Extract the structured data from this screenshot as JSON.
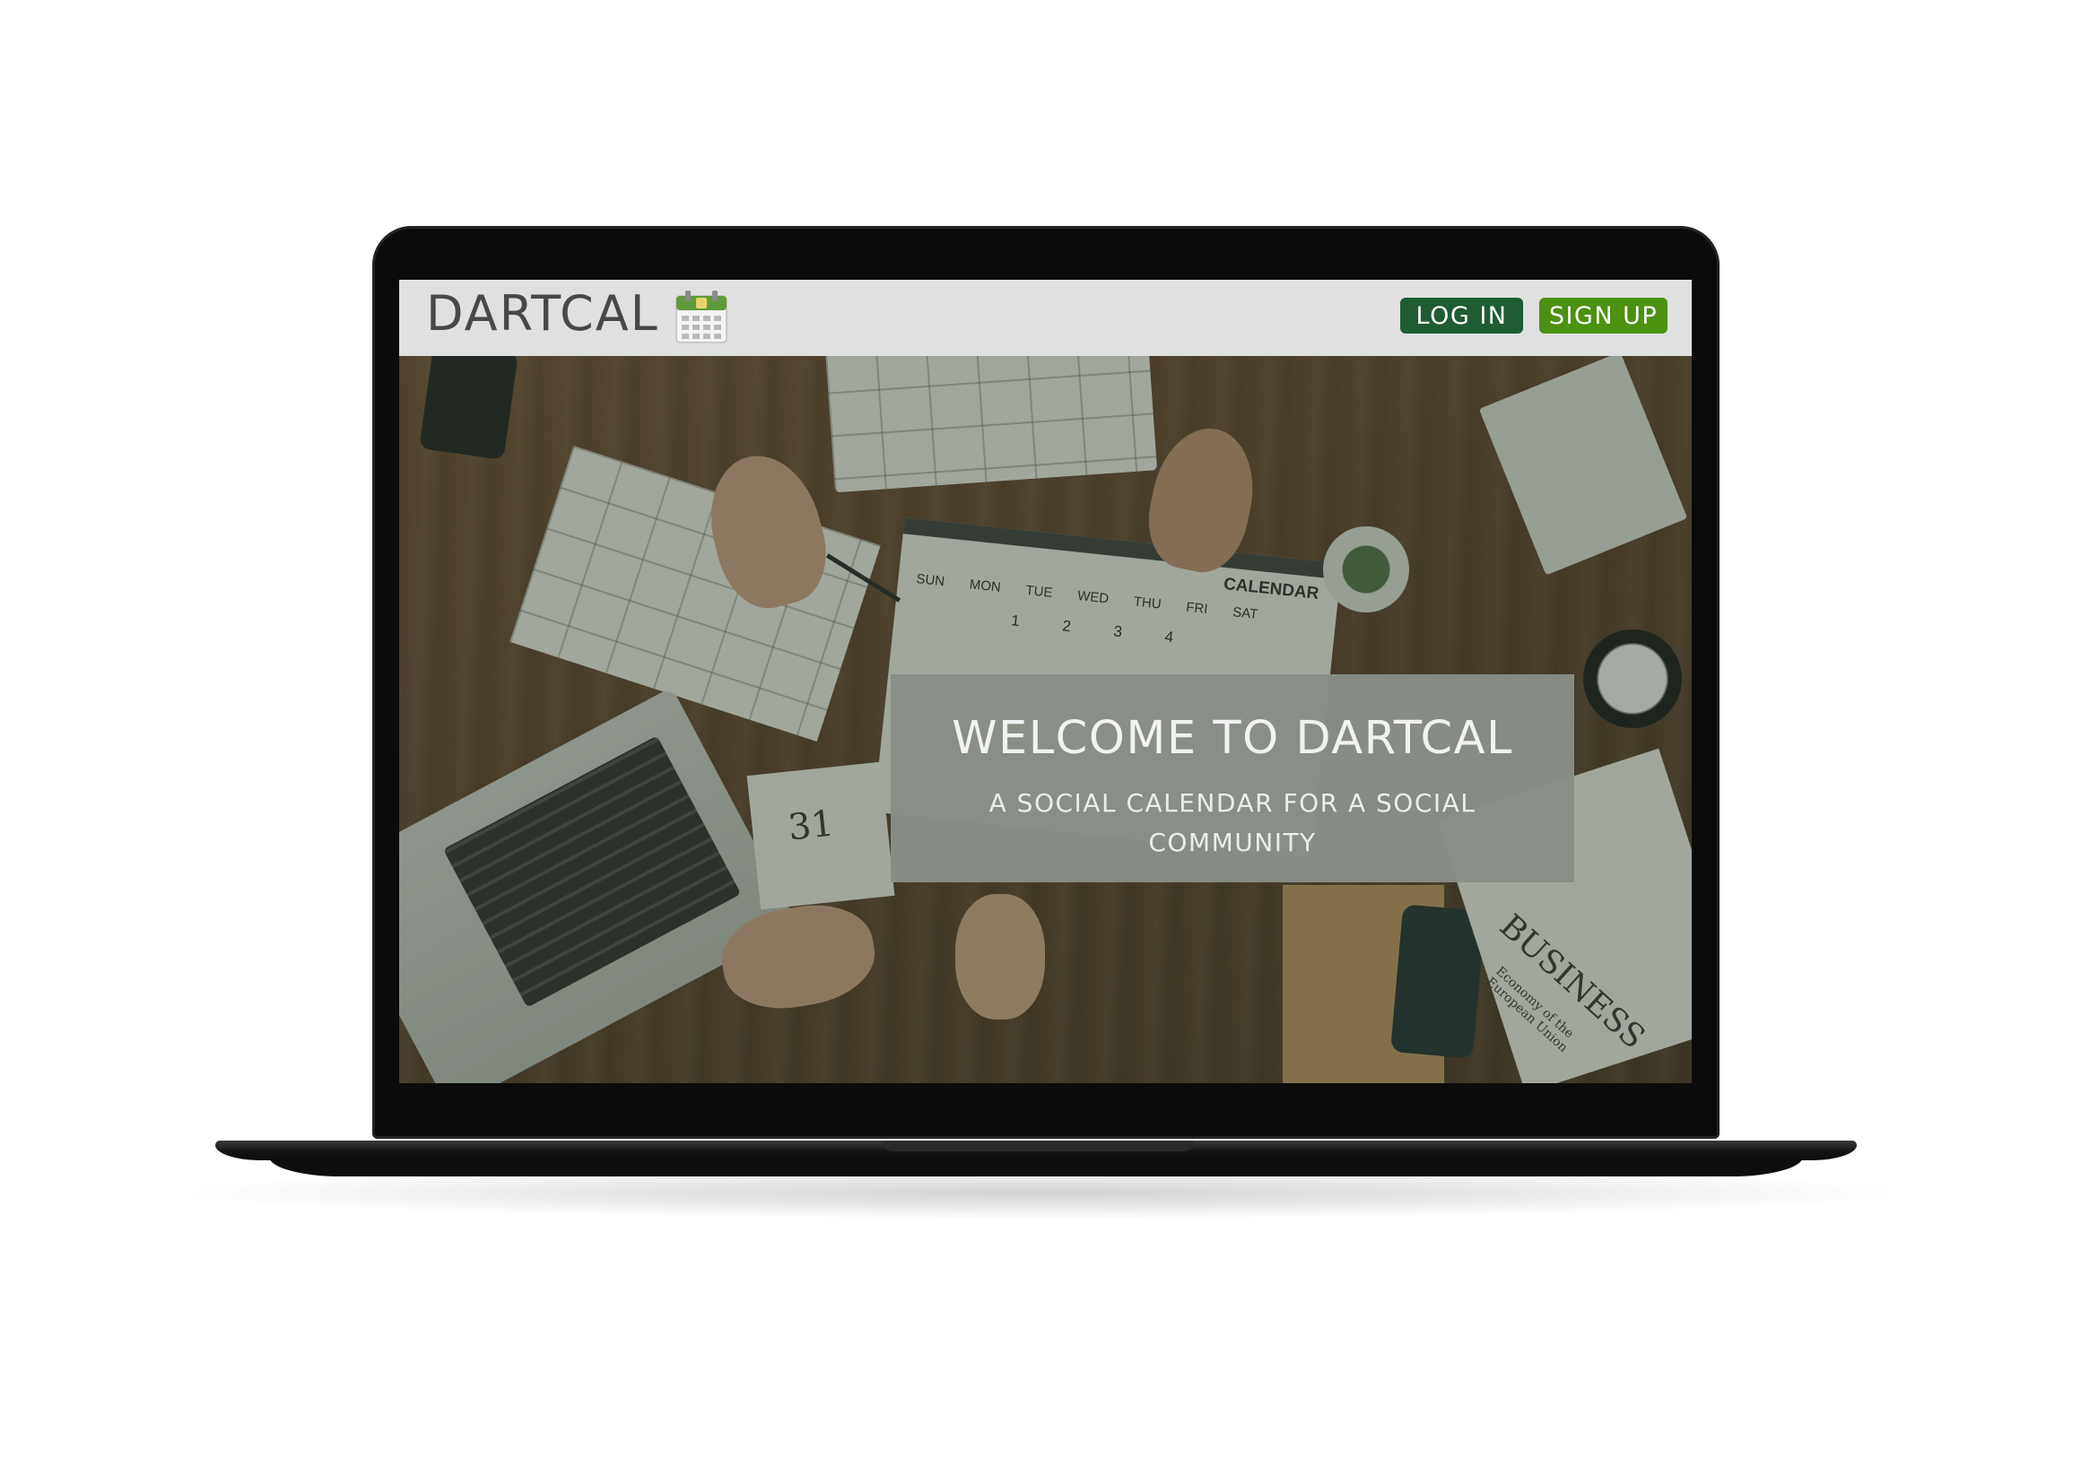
{
  "site": {
    "brand": "DARTCAL",
    "logo_icon": "calendar-icon"
  },
  "nav": {
    "login_label": "LOG IN",
    "signup_label": "SIGN UP"
  },
  "hero": {
    "title": "WELCOME TO DARTCAL",
    "subtitle": "A SOCIAL CALENDAR FOR A SOCIAL COMMUNITY"
  },
  "hero_image_text": {
    "calendar_heading": "CALENDAR",
    "weekdays": [
      "SUN",
      "MON",
      "TUE",
      "WED",
      "THU",
      "FRI",
      "SAT"
    ],
    "dates": [
      "1",
      "2",
      "3",
      "4"
    ],
    "desk_calendar_day": "31",
    "newspaper_title": "BUSINESS",
    "newspaper_sub": "Economy of the European Union"
  },
  "colors": {
    "header_bg": "#dfe1e0",
    "login_bg": "#1f5c34",
    "signup_bg": "#4c9110",
    "welcome_box_bg": "#888e86"
  }
}
